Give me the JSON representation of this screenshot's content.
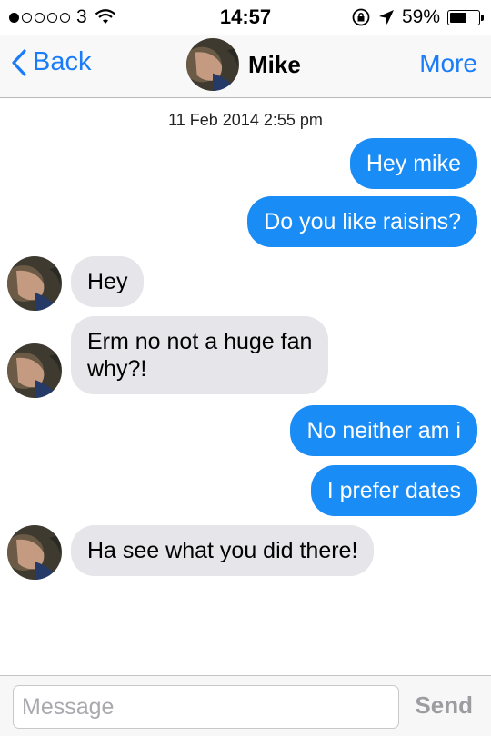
{
  "status_bar": {
    "carrier": "3",
    "time": "14:57",
    "battery": "59%",
    "signal_bars_filled": 1,
    "signal_bars_total": 5,
    "battery_level": 0.59
  },
  "nav": {
    "back_label": "Back",
    "title": "Mike",
    "more_label": "More"
  },
  "thread": {
    "timestamp": "11 Feb 2014 2:55 pm",
    "messages": [
      {
        "direction": "outgoing",
        "text": "Hey mike"
      },
      {
        "direction": "outgoing",
        "text": "Do you like raisins?"
      },
      {
        "direction": "incoming",
        "text": "Hey"
      },
      {
        "direction": "incoming",
        "line1": "Erm no not a huge fan",
        "line2": "why?!"
      },
      {
        "direction": "outgoing",
        "text": "No neither am i"
      },
      {
        "direction": "outgoing",
        "text": "I prefer dates"
      },
      {
        "direction": "incoming",
        "text": "Ha see what you did there!"
      }
    ]
  },
  "composer": {
    "placeholder": "Message",
    "send_label": "Send"
  },
  "colors": {
    "accent": "#1a7cf8",
    "outgoing_bubble": "#1a8cf5",
    "incoming_bubble": "#e5e5ea"
  }
}
